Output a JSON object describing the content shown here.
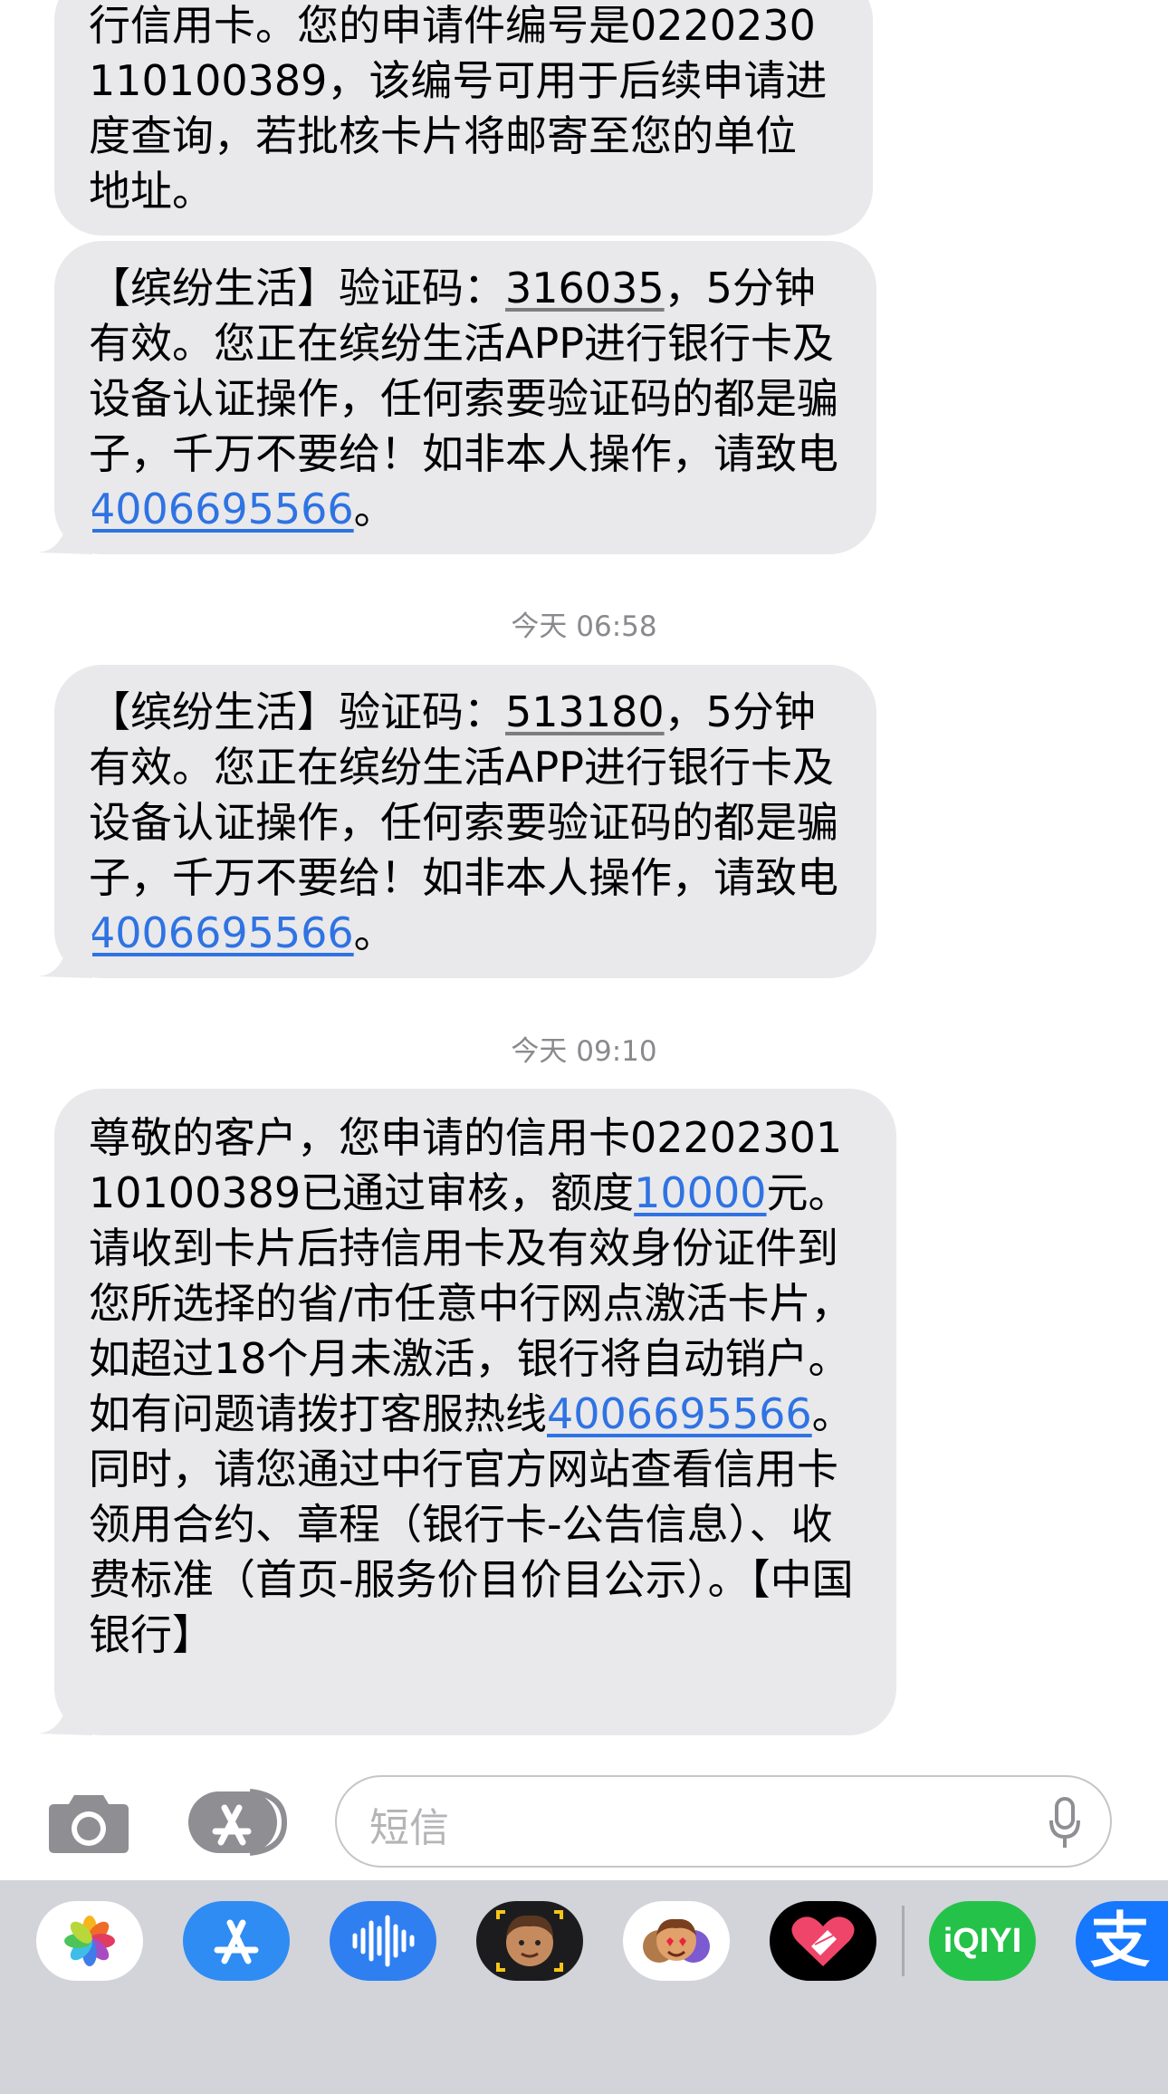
{
  "messages": [
    {
      "text_a": "行信用卡。您的申请件编号是022023011010038​9，该编号可用于后续申请进度查询，若批核卡片将邮寄至您的单位地址。"
    },
    {
      "prefix": "【缤纷生活】验证码：",
      "code": "316035",
      "middle": "，5分钟有效。您正在缤纷生活APP进行银行卡及设备认证操作，任何索要验证码的都是骗子，千万不要给！如非本人操作，请致电",
      "phone": "4006695566",
      "suffix": "。"
    },
    {
      "prefix": "【缤纷生活】验证码：",
      "code": "513180",
      "middle": "，5分钟有效。您正在缤纷生活APP进行银行卡及设备认证操作，任何索要验证码的都是骗子，千万不要给！如非本人操作，请致电",
      "phone": "4006695566",
      "suffix": "。"
    },
    {
      "part1": "尊敬的客户，您申请的信用卡022023011010038​9已通过审核，额度",
      "amount": "10000",
      "part2": "元。请收到卡片后持信用卡及有效身份证件到您所选择的省/市任意中行网点激活卡片，如超过18个月未激活，银行将自动销户。如有问题请拨打客服热线",
      "phone": "4006695566",
      "part3": "。同时，请您通过中行官方网站查看信用卡领用合约、章程（银行卡-公告信息）、收费标准（首页-服务价目价目公示）。【中国银行】"
    }
  ],
  "timestamps": [
    "今天 06:58",
    "今天 09:10"
  ],
  "input": {
    "placeholder": "短信"
  },
  "icons": {
    "camera": "camera-icon",
    "apps": "app-store-icon",
    "mic": "microphone-icon"
  },
  "drawer_apps": [
    "photos-app",
    "app-store-app",
    "audio-app",
    "memoji-app",
    "animoji-app",
    "digital-touch-app",
    "iqiyi-app",
    "alipay-app"
  ],
  "drawer_labels": {
    "iqiyi": "iQIYI",
    "alipay": "支"
  },
  "colors": {
    "bubble": "#e9e9eb",
    "link": "#2f73e3",
    "drawer": "#d2d4da"
  }
}
